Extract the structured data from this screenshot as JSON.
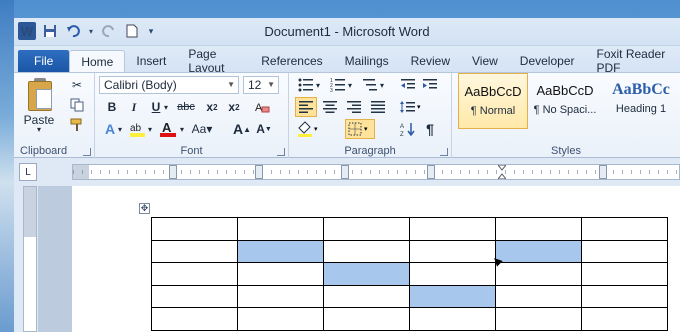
{
  "window": {
    "title": "Document1  -  Microsoft Word"
  },
  "qat": {
    "app_icon": "W",
    "save_icon": "save-icon",
    "undo_icon": "undo-icon",
    "redo_icon": "redo-icon",
    "new_icon": "new-document-icon"
  },
  "tabs": [
    {
      "label": "File"
    },
    {
      "label": "Home"
    },
    {
      "label": "Insert"
    },
    {
      "label": "Page Layout"
    },
    {
      "label": "References"
    },
    {
      "label": "Mailings"
    },
    {
      "label": "Review"
    },
    {
      "label": "View"
    },
    {
      "label": "Developer"
    },
    {
      "label": "Foxit Reader PDF"
    }
  ],
  "clipboard": {
    "label": "Clipboard",
    "paste_label": "Paste"
  },
  "font": {
    "label": "Font",
    "name": "Calibri (Body)",
    "size": "12"
  },
  "paragraph": {
    "label": "Paragraph"
  },
  "styles": {
    "label": "Styles",
    "items": [
      {
        "sample": "AaBbCcD",
        "name": "¶ Normal"
      },
      {
        "sample": "AaBbCcD",
        "name": "¶ No Spaci..."
      },
      {
        "sample": "AaBbCc",
        "name": "Heading 1"
      }
    ]
  },
  "table": {
    "rows": 5,
    "cols": 6,
    "highlighted": [
      [
        1,
        1
      ],
      [
        1,
        4
      ],
      [
        2,
        2
      ],
      [
        3,
        3
      ]
    ]
  },
  "colors": {
    "accent": "#2b579a",
    "highlight": "#a7c8ec"
  }
}
